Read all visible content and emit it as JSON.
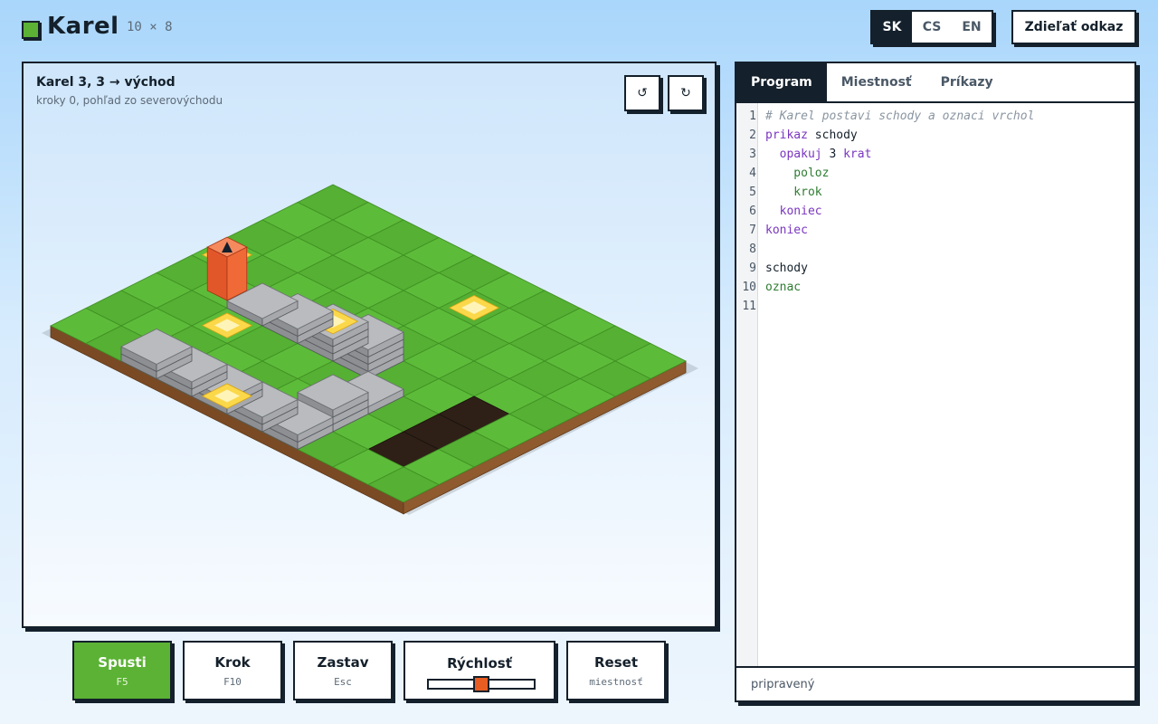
{
  "app": {
    "title": "Karel",
    "grid_size": "10 × 8",
    "accent": "#5bb234",
    "dark": "#14202b"
  },
  "languages": [
    {
      "code": "SK",
      "active": true
    },
    {
      "code": "CS",
      "active": false
    },
    {
      "code": "EN",
      "active": false
    }
  ],
  "share_label": "Zdieľať odkaz",
  "stage": {
    "title": "Karel 3, 3 → východ",
    "subtitle": "kroky 0, pohľad zo severovýchodu",
    "rotate_left_icon": "↺",
    "rotate_right_icon": "↻"
  },
  "world": {
    "cols": 10,
    "rows": 8,
    "karel": {
      "col": 1,
      "row": 3,
      "facing": "east"
    },
    "walls": [
      {
        "col": 2,
        "row": 0,
        "h": 2
      },
      {
        "col": 3,
        "row": 0,
        "h": 2
      },
      {
        "col": 4,
        "row": 0,
        "h": 2
      },
      {
        "col": 5,
        "row": 0,
        "h": 2
      },
      {
        "col": 6,
        "row": 0,
        "h": 2
      },
      {
        "col": 6,
        "row": 1,
        "h": 3
      },
      {
        "col": 6,
        "row": 2,
        "h": 1
      },
      {
        "col": 2,
        "row": 3,
        "h": 1
      },
      {
        "col": 3,
        "row": 3,
        "h": 2
      },
      {
        "col": 4,
        "row": 3,
        "h": 3
      },
      {
        "col": 5,
        "row": 3,
        "h": 4
      }
    ],
    "marks": [
      {
        "col": 0,
        "row": 4,
        "h": 0
      },
      {
        "col": 4,
        "row": 0,
        "h": 0
      },
      {
        "col": 2,
        "row": 2,
        "h": 0
      },
      {
        "col": 4,
        "row": 3,
        "h": 3
      },
      {
        "col": 5,
        "row": 6,
        "h": 0
      }
    ],
    "holes": [
      {
        "col": 8,
        "row": 1
      },
      {
        "col": 8,
        "row": 2
      },
      {
        "col": 8,
        "row": 3
      }
    ]
  },
  "tabs": [
    {
      "label": "Program",
      "active": true
    },
    {
      "label": "Miestnosť",
      "active": false
    },
    {
      "label": "Príkazy",
      "active": false
    }
  ],
  "code_lines": [
    [
      {
        "t": "# Karel postavi schody a oznaci vrchol",
        "c": "comment"
      }
    ],
    [
      {
        "t": "prikaz",
        "c": "kw"
      },
      {
        "t": " schody",
        "c": "name"
      }
    ],
    [
      {
        "t": "  opakuj",
        "c": "kw"
      },
      {
        "t": " 3 ",
        "c": "name"
      },
      {
        "t": "krat",
        "c": "kw"
      }
    ],
    [
      {
        "t": "    poloz",
        "c": "cmd"
      }
    ],
    [
      {
        "t": "    krok",
        "c": "cmd"
      }
    ],
    [
      {
        "t": "  koniec",
        "c": "kw"
      }
    ],
    [
      {
        "t": "koniec",
        "c": "kw"
      }
    ],
    [],
    [
      {
        "t": "schody",
        "c": "name"
      }
    ],
    [
      {
        "t": "oznac",
        "c": "cmd"
      }
    ],
    []
  ],
  "status": "pripravený",
  "controls": {
    "run": {
      "label": "Spusti",
      "key": "F5"
    },
    "step": {
      "label": "Krok",
      "key": "F10"
    },
    "stop": {
      "label": "Zastav",
      "key": "Esc"
    },
    "speed": {
      "label": "Rýchlosť",
      "value": 0.5
    },
    "reset": {
      "label": "Reset",
      "key": "miestnosť"
    }
  }
}
